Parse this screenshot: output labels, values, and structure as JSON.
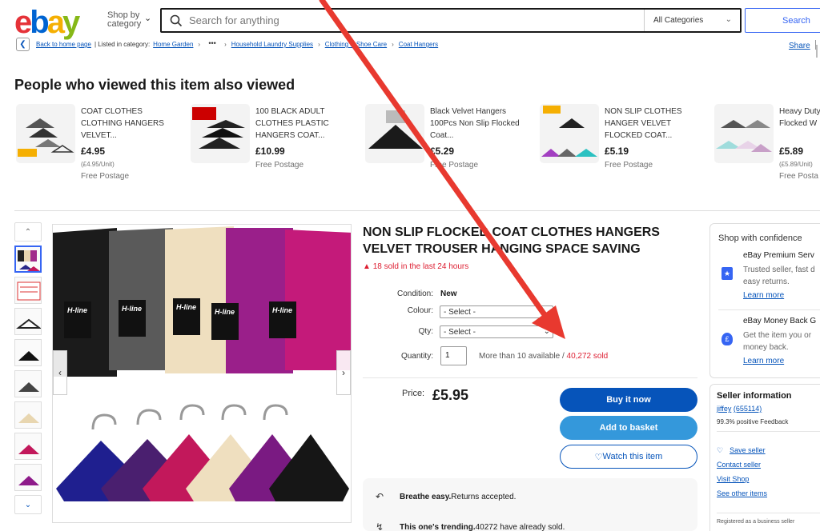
{
  "header": {
    "logo": {
      "e": "e",
      "b": "b",
      "a": "a",
      "y": "y"
    },
    "shop_by_line1": "Shop by",
    "shop_by_line2": "category",
    "search_placeholder": "Search for anything",
    "category_select": "All Categories",
    "search_button": "Search"
  },
  "breadcrumb": {
    "back_home": "Back to home page",
    "listed_in": "| Listed in category:",
    "items": [
      "Home Garden",
      "Household Laundry Supplies",
      "Clothing & Shoe Care",
      "Coat Hangers"
    ],
    "more": "•••"
  },
  "share": "Share",
  "viewed": {
    "title": "People who viewed this item also viewed",
    "items": [
      {
        "title": "COAT CLOTHES CLOTHING HANGERS VELVET...",
        "price": "£4.95",
        "unit": "(£4.95/Unit)",
        "shipping": "Free Postage"
      },
      {
        "title": "100 BLACK ADULT CLOTHES PLASTIC HANGERS COAT...",
        "price": "£10.99",
        "unit": "",
        "shipping": "Free Postage"
      },
      {
        "title": "Black Velvet Hangers 100Pcs Non Slip Flocked Coat...",
        "price": "£5.29",
        "unit": "",
        "shipping": "Free Postage"
      },
      {
        "title": "NON SLIP CLOTHES HANGER VELVET FLOCKED COAT...",
        "price": "£5.19",
        "unit": "",
        "shipping": "Free Postage"
      },
      {
        "title": "Heavy Duty Hangers N Flocked W",
        "price": "£5.89",
        "unit": "(£5.89/Unit)",
        "shipping": "Free Posta"
      }
    ]
  },
  "gallery": {
    "image_logo_text": "H-line"
  },
  "item": {
    "title": "NON SLIP FLOCKED COAT CLOTHES HANGERS VELVET TROUSER HANGING SPACE SAVING",
    "sold_24h": "18 sold in the last 24 hours",
    "condition_label": "Condition:",
    "condition_value": "New",
    "colour_label": "Colour:",
    "colour_value": "- Select -",
    "qty_label": "Qty:",
    "qty_value": "- Select -",
    "quantity_label": "Quantity:",
    "quantity_value": "1",
    "available": "More than 10 available / ",
    "sold_total": "40,272 sold",
    "price_label": "Price:",
    "price": "£5.95",
    "buy_now": "Buy it now",
    "add_basket": "Add to basket",
    "watch": "Watch this item",
    "breathe_bold": "Breathe easy.",
    "breathe_text": " Returns accepted.",
    "trending_bold": "This one's trending.",
    "trending_text": " 40272 have already sold."
  },
  "confidence": {
    "title": "Shop with confidence",
    "premium_title": "eBay Premium Serv",
    "premium_desc_1": "Trusted seller, fast d",
    "premium_desc_2": "easy returns.",
    "premium_link": "Learn more",
    "mbg_title": "eBay Money Back G",
    "mbg_desc_1": "Get the item you or",
    "mbg_desc_2": "money back.",
    "mbg_link": "Learn more"
  },
  "seller": {
    "title": "Seller information",
    "name": "jiffey",
    "score": "(655114)",
    "feedback": "99.3% positive Feedback",
    "save": "Save seller",
    "contact": "Contact seller",
    "visit": "Visit Shop",
    "other": "See other items",
    "registered": "Registered as a business seller"
  },
  "colors": {
    "ebay_red": "#e53238",
    "ebay_blue": "#0064d2",
    "ebay_yellow": "#f5af02",
    "ebay_green": "#86b817",
    "buy_button": "#0654ba",
    "annotation_arrow": "#e8392f"
  }
}
